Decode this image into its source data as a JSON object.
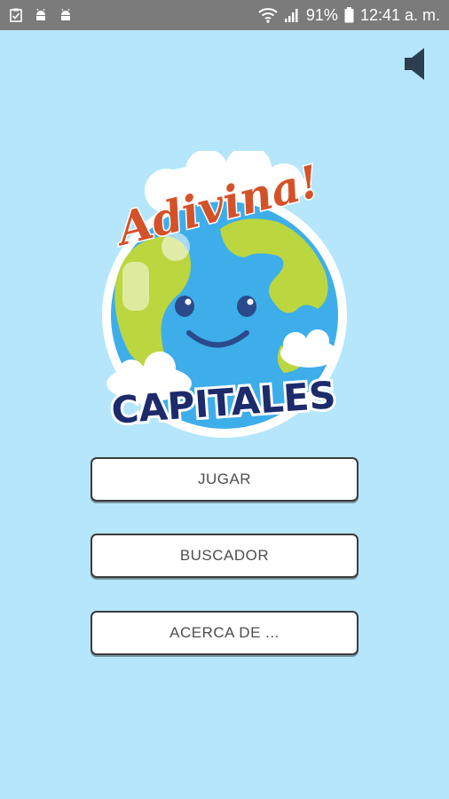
{
  "status_bar": {
    "left_icons": [
      "clipboard-check-icon",
      "android-icon",
      "android-icon"
    ],
    "wifi_icon": "wifi-icon",
    "signal_icon": "signal-icon",
    "battery_percent": "91%",
    "battery_icon": "battery-icon",
    "time": "12:41 a. m."
  },
  "toolbar": {
    "sound_icon": "speaker-icon"
  },
  "logo": {
    "title_script": "Adivina!",
    "title_main": "CAPITALES"
  },
  "menu": {
    "play_label": "JUGAR",
    "search_label": "BUSCADOR",
    "about_label": "ACERCA DE ..."
  },
  "colors": {
    "background": "#b5e6fb",
    "status_bar": "#7b7b7b",
    "ocean": "#3eaeea",
    "land": "#bcd63f",
    "title_red": "#d4522a",
    "title_navy": "#1d2b6b"
  }
}
